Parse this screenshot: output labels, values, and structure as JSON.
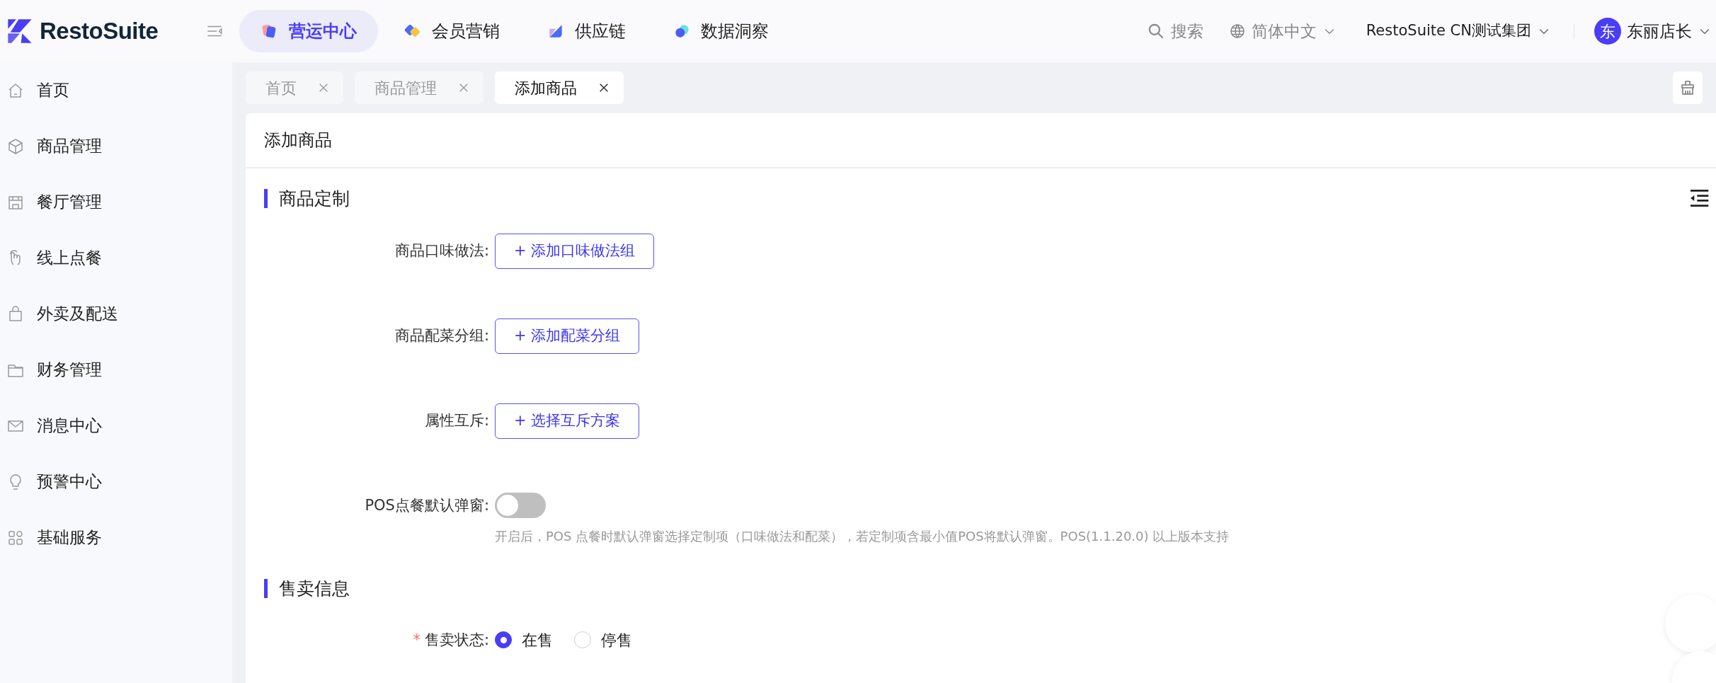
{
  "header": {
    "logo": "RestoSuite",
    "nav": [
      {
        "label": "营运中心",
        "selected": true
      },
      {
        "label": "会员营销",
        "selected": false
      },
      {
        "label": "供应链",
        "selected": false
      },
      {
        "label": "数据洞察",
        "selected": false
      }
    ],
    "search": "搜索",
    "language": "简体中文",
    "organization": "RestoSuite CN测试集团",
    "user": {
      "avatar": "东",
      "name": "东丽店长"
    }
  },
  "sidebar": {
    "items": [
      {
        "label": "首页"
      },
      {
        "label": "商品管理"
      },
      {
        "label": "餐厅管理"
      },
      {
        "label": "线上点餐"
      },
      {
        "label": "外卖及配送"
      },
      {
        "label": "财务管理"
      },
      {
        "label": "消息中心"
      },
      {
        "label": "预警中心"
      },
      {
        "label": "基础服务"
      }
    ]
  },
  "tabs": [
    {
      "label": "首页",
      "selected": false
    },
    {
      "label": "商品管理",
      "selected": false
    },
    {
      "label": "添加商品",
      "selected": true
    }
  ],
  "page": {
    "title": "添加商品",
    "sections": [
      {
        "title": "商品定制",
        "fields": [
          {
            "kind": "button",
            "label": "商品口味做法:",
            "button": "+ 添加口味做法组"
          },
          {
            "kind": "button",
            "label": "商品配菜分组:",
            "button": "+ 添加配菜分组"
          },
          {
            "kind": "button",
            "label": "属性互斥:",
            "button": "+ 选择互斥方案"
          },
          {
            "kind": "switch",
            "label": "POS点餐默认弹窗:",
            "on": false,
            "hint": "开启后，POS 点餐时默认弹窗选择定制项（口味做法和配菜），若定制项含最小值POS将默认弹窗。POS(1.1.20.0) 以上版本支持"
          }
        ]
      },
      {
        "title": "售卖信息",
        "fields": [
          {
            "kind": "radio",
            "label": "售卖状态:",
            "required_mark": "*",
            "options": [
              {
                "label": "在售",
                "selected": true
              },
              {
                "label": "停售",
                "selected": false
              }
            ]
          }
        ]
      }
    ]
  }
}
